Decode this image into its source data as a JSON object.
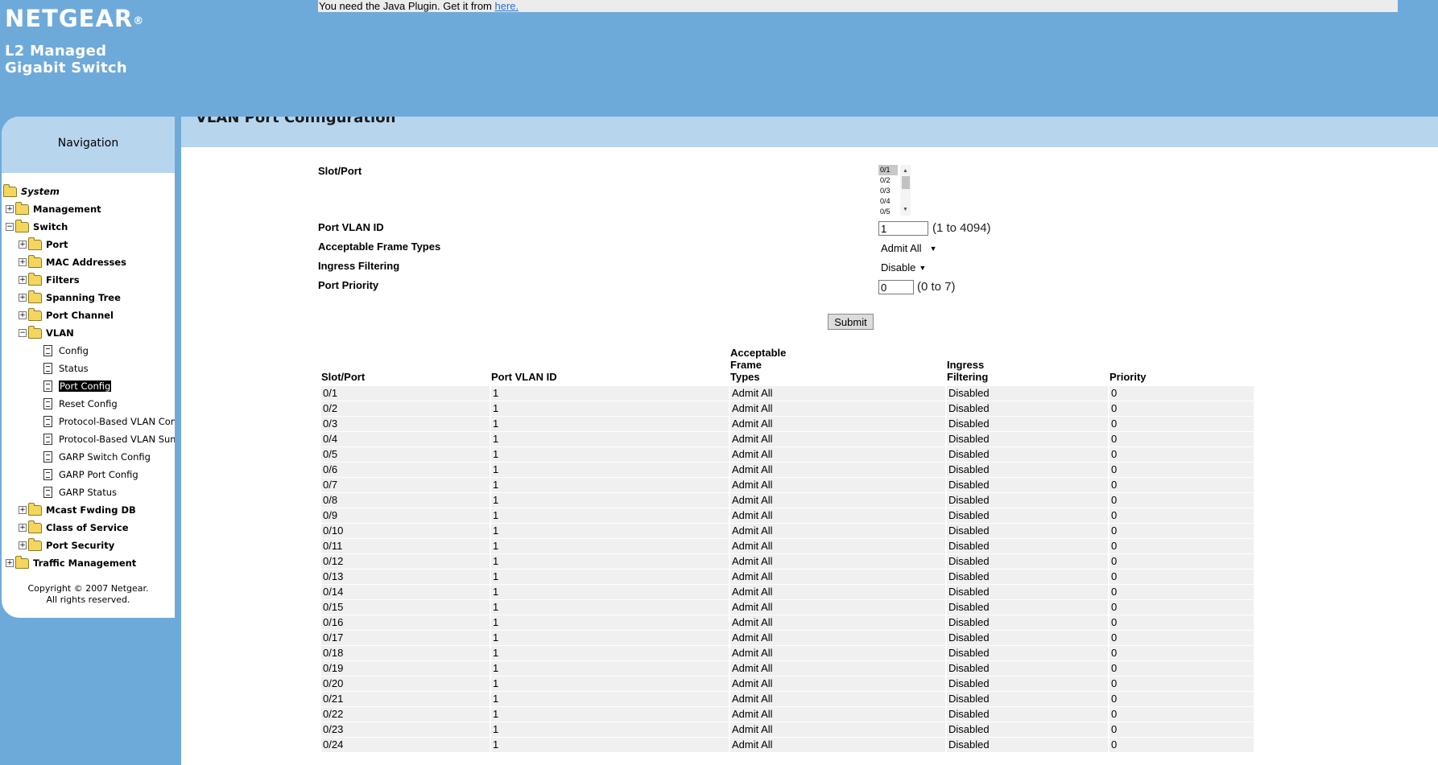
{
  "header": {
    "brand": "NETGEAR",
    "brand_mark": "®",
    "product_line1": "L2 Managed",
    "product_line2": "Gigabit Switch",
    "java_notice": "You need the Java Plugin. Get it from ",
    "java_link": "here."
  },
  "navigation": {
    "title": "Navigation",
    "items": [
      {
        "label": "System",
        "level": 0,
        "kind": "folder-open",
        "expander": "",
        "italic": true
      },
      {
        "label": "Management",
        "level": 1,
        "kind": "folder",
        "expander": "+"
      },
      {
        "label": "Switch",
        "level": 1,
        "kind": "folder-open",
        "expander": "-"
      },
      {
        "label": "Port",
        "level": 2,
        "kind": "folder",
        "expander": "+"
      },
      {
        "label": "MAC Addresses",
        "level": 2,
        "kind": "folder",
        "expander": "+"
      },
      {
        "label": "Filters",
        "level": 2,
        "kind": "folder",
        "expander": "+"
      },
      {
        "label": "Spanning Tree",
        "level": 2,
        "kind": "folder",
        "expander": "+"
      },
      {
        "label": "Port Channel",
        "level": 2,
        "kind": "folder",
        "expander": "+"
      },
      {
        "label": "VLAN",
        "level": 2,
        "kind": "folder-open",
        "expander": "-"
      },
      {
        "label": "Config",
        "level": 3,
        "kind": "doc"
      },
      {
        "label": "Status",
        "level": 3,
        "kind": "doc"
      },
      {
        "label": "Port Config",
        "level": 3,
        "kind": "doc",
        "selected": true
      },
      {
        "label": "Reset Config",
        "level": 3,
        "kind": "doc"
      },
      {
        "label": "Protocol-Based VLAN Confi",
        "level": 3,
        "kind": "doc"
      },
      {
        "label": "Protocol-Based VLAN Sumn",
        "level": 3,
        "kind": "doc"
      },
      {
        "label": "GARP Switch Config",
        "level": 3,
        "kind": "doc"
      },
      {
        "label": "GARP Port Config",
        "level": 3,
        "kind": "doc"
      },
      {
        "label": "GARP Status",
        "level": 3,
        "kind": "doc"
      },
      {
        "label": "Mcast Fwding DB",
        "level": 2,
        "kind": "folder",
        "expander": "+"
      },
      {
        "label": "Class of Service",
        "level": 2,
        "kind": "folder",
        "expander": "+"
      },
      {
        "label": "Port Security",
        "level": 2,
        "kind": "folder",
        "expander": "+"
      },
      {
        "label": "Traffic Management",
        "level": 1,
        "kind": "folder",
        "expander": "+"
      }
    ],
    "copyright_line1": "Copyright © 2007 Netgear.",
    "copyright_line2": "All rights reserved."
  },
  "page": {
    "title": "VLAN Port Configuration"
  },
  "form": {
    "slot_port_label": "Slot/Port",
    "slot_port_options": [
      "0/1",
      "0/2",
      "0/3",
      "0/4",
      "0/5"
    ],
    "slot_port_selected": "0/1",
    "pvid_label": "Port VLAN ID",
    "pvid_value": "1",
    "pvid_hint": "(1 to 4094)",
    "frame_types_label": "Acceptable Frame Types",
    "frame_types_value": "Admit All",
    "ingress_label": "Ingress Filtering",
    "ingress_value": "Disable",
    "priority_label": "Port Priority",
    "priority_value": "0",
    "priority_hint": "(0 to 7)",
    "submit_label": "Submit"
  },
  "table": {
    "columns": [
      "Slot/Port",
      "Port VLAN ID",
      "Acceptable\nFrame\nTypes",
      "Ingress\nFiltering",
      "Priority"
    ],
    "rows": [
      [
        "0/1",
        "1",
        "Admit All",
        "Disabled",
        "0"
      ],
      [
        "0/2",
        "1",
        "Admit All",
        "Disabled",
        "0"
      ],
      [
        "0/3",
        "1",
        "Admit All",
        "Disabled",
        "0"
      ],
      [
        "0/4",
        "1",
        "Admit All",
        "Disabled",
        "0"
      ],
      [
        "0/5",
        "1",
        "Admit All",
        "Disabled",
        "0"
      ],
      [
        "0/6",
        "1",
        "Admit All",
        "Disabled",
        "0"
      ],
      [
        "0/7",
        "1",
        "Admit All",
        "Disabled",
        "0"
      ],
      [
        "0/8",
        "1",
        "Admit All",
        "Disabled",
        "0"
      ],
      [
        "0/9",
        "1",
        "Admit All",
        "Disabled",
        "0"
      ],
      [
        "0/10",
        "1",
        "Admit All",
        "Disabled",
        "0"
      ],
      [
        "0/11",
        "1",
        "Admit All",
        "Disabled",
        "0"
      ],
      [
        "0/12",
        "1",
        "Admit All",
        "Disabled",
        "0"
      ],
      [
        "0/13",
        "1",
        "Admit All",
        "Disabled",
        "0"
      ],
      [
        "0/14",
        "1",
        "Admit All",
        "Disabled",
        "0"
      ],
      [
        "0/15",
        "1",
        "Admit All",
        "Disabled",
        "0"
      ],
      [
        "0/16",
        "1",
        "Admit All",
        "Disabled",
        "0"
      ],
      [
        "0/17",
        "1",
        "Admit All",
        "Disabled",
        "0"
      ],
      [
        "0/18",
        "1",
        "Admit All",
        "Disabled",
        "0"
      ],
      [
        "0/19",
        "1",
        "Admit All",
        "Disabled",
        "0"
      ],
      [
        "0/20",
        "1",
        "Admit All",
        "Disabled",
        "0"
      ],
      [
        "0/21",
        "1",
        "Admit All",
        "Disabled",
        "0"
      ],
      [
        "0/22",
        "1",
        "Admit All",
        "Disabled",
        "0"
      ],
      [
        "0/23",
        "1",
        "Admit All",
        "Disabled",
        "0"
      ],
      [
        "0/24",
        "1",
        "Admit All",
        "Disabled",
        "0"
      ]
    ]
  },
  "colors": {
    "page_background": "#6eaad9",
    "band": "#b8d5ee",
    "row_fill": "#f0f0f0",
    "link": "#2a6fd1"
  }
}
